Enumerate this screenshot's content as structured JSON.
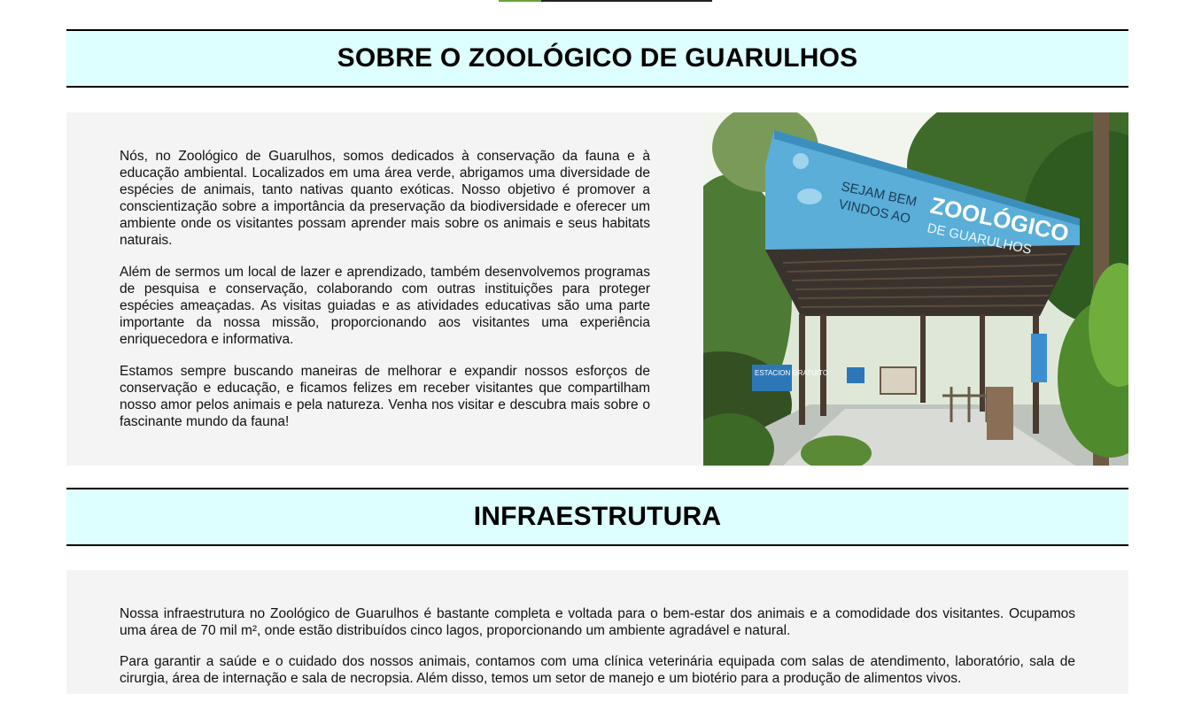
{
  "about": {
    "title": "SOBRE O ZOOLÓGICO DE GUARULHOS",
    "paragraphs": [
      "Nós, no Zoológico de Guarulhos, somos dedicados à conservação da fauna e à educação ambiental. Localizados em uma área verde, abrigamos uma diversidade de espécies de animais, tanto nativas quanto exóticas. Nosso objetivo é promover a conscientização sobre a importância da preservação da biodiversidade e oferecer um ambiente onde os visitantes possam aprender mais sobre os animais e seus habitats naturais.",
      "Além de sermos um local de lazer e aprendizado, também desenvolvemos programas de pesquisa e conservação, colaborando com outras instituições para proteger espécies ameaçadas. As visitas guiadas e as atividades educativas são uma parte importante da nossa missão, proporcionando aos visitantes uma experiência enriquecedora e informativa.",
      "Estamos sempre buscando maneiras de melhorar e expandir nossos esforços de conservação e educação, e ficamos felizes em receber visitantes que compartilham nosso amor pelos animais e pela natureza. Venha nos visitar e descubra mais sobre o fascinante mundo da fauna!"
    ],
    "photo": {
      "sign_line1": "SEJAM BEM",
      "sign_line2": "VINDOS AO",
      "sign_brand": "ZOOLÓGICO",
      "sign_city": "DE GUARULHOS",
      "parking_sign": "ESTACION GRATUITO"
    }
  },
  "infra": {
    "title": "INFRAESTRUTURA",
    "paragraphs": [
      "Nossa infraestrutura no Zoológico de Guarulhos é bastante completa e voltada para o bem-estar dos animais e a comodidade dos visitantes. Ocupamos uma área de 70 mil m², onde estão distribuídos cinco lagos, proporcionando um ambiente agradável e natural.",
      "Para garantir a saúde e o cuidado dos nossos animais, contamos com uma clínica veterinária equipada com salas de atendimento, laboratório, sala de cirurgia, área de internação e sala de necropsia. Além disso, temos um setor de manejo e um biotério para a produção de alimentos vivos."
    ]
  },
  "colors": {
    "header_bg": "#ddffff",
    "panel_bg": "#f4f4f4",
    "indicator_active": "#6aa33a",
    "sign_blue": "#5aaed8"
  }
}
